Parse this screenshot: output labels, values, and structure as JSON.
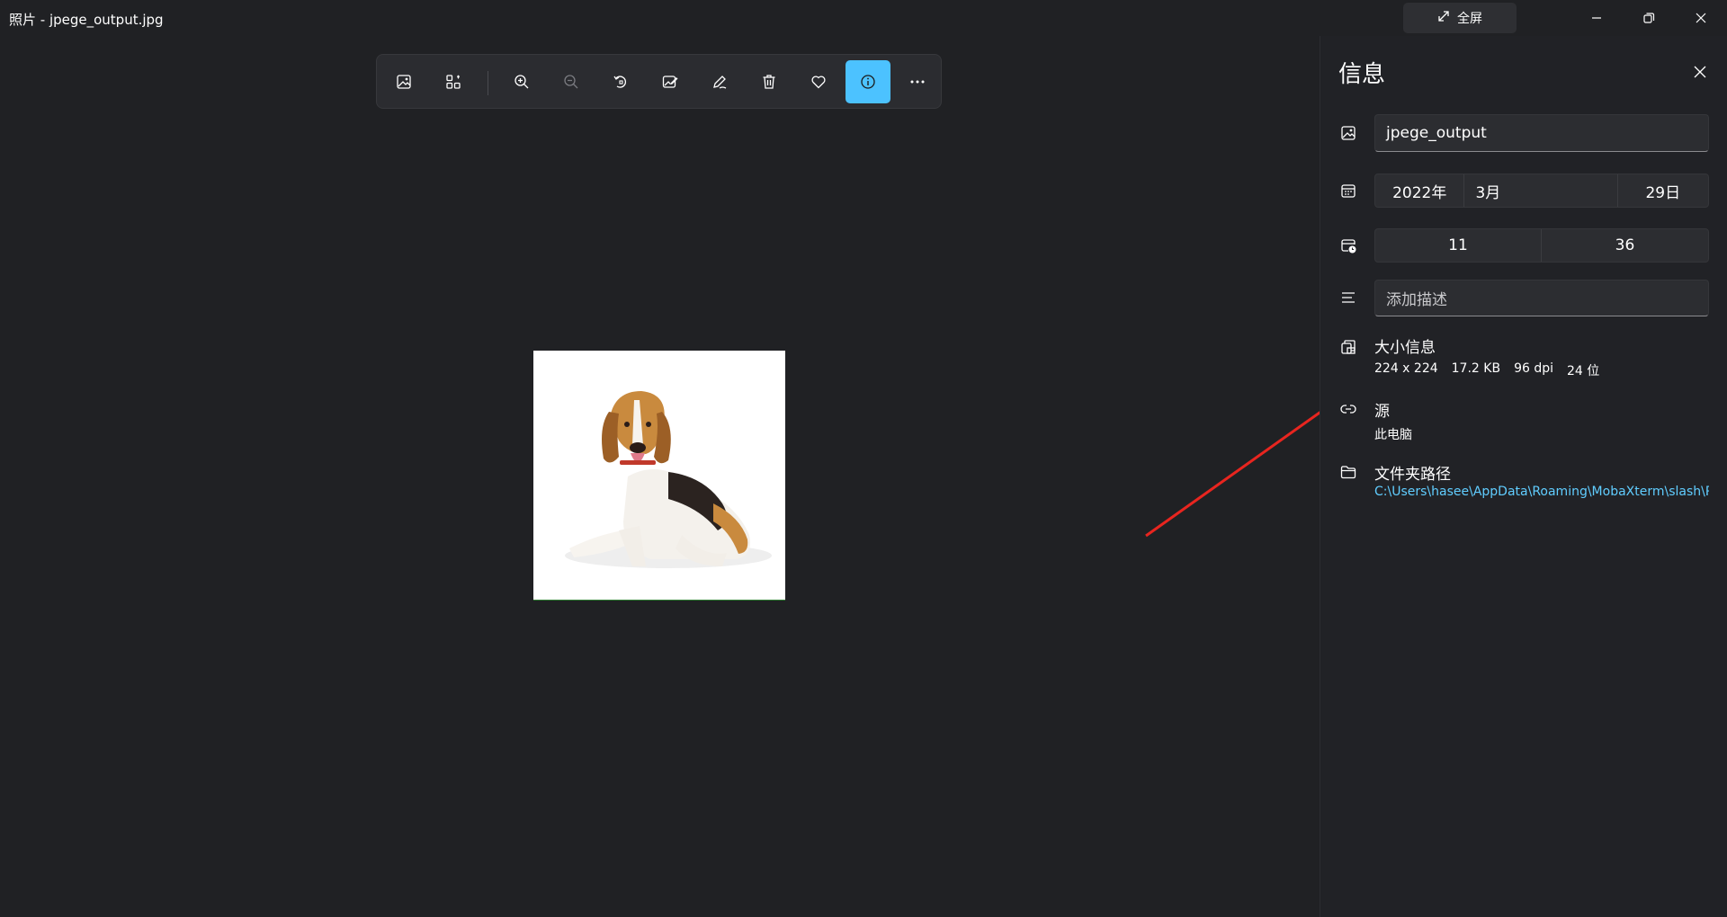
{
  "window": {
    "title": "照片 - jpege_output.jpg",
    "fullscreen_label": "全屏"
  },
  "toolbar": {
    "items": [
      {
        "name": "image-icon"
      },
      {
        "name": "gallery-icon"
      },
      {
        "name": "zoom-in-icon"
      },
      {
        "name": "zoom-out-icon"
      },
      {
        "name": "rotate-icon"
      },
      {
        "name": "edit-image-icon"
      },
      {
        "name": "draw-icon"
      },
      {
        "name": "delete-icon"
      },
      {
        "name": "favorite-icon"
      },
      {
        "name": "info-icon"
      },
      {
        "name": "more-icon"
      }
    ],
    "active_color": "#4cc2ff"
  },
  "panel": {
    "title": "信息",
    "file_name": "jpege_output",
    "date": {
      "year": "2022年",
      "month": "3月",
      "day": "29日"
    },
    "time": {
      "hour": "11",
      "minute": "36"
    },
    "description_placeholder": "添加描述",
    "size": {
      "heading": "大小信息",
      "dimensions": "224 x 224",
      "file_size": "17.2 KB",
      "dpi": "96 dpi",
      "bit_depth": "24 位"
    },
    "source": {
      "heading": "源",
      "value": "此电脑"
    },
    "folder": {
      "heading": "文件夹路径",
      "path": "C:\\Users\\hasee\\AppData\\Roaming\\MobaXterm\\slash\\R"
    }
  },
  "colors": {
    "background": "#202124",
    "panel": "#212226",
    "accent": "#4cc2ff",
    "link": "#60cdff",
    "annotation_arrow": "#e8251f"
  }
}
